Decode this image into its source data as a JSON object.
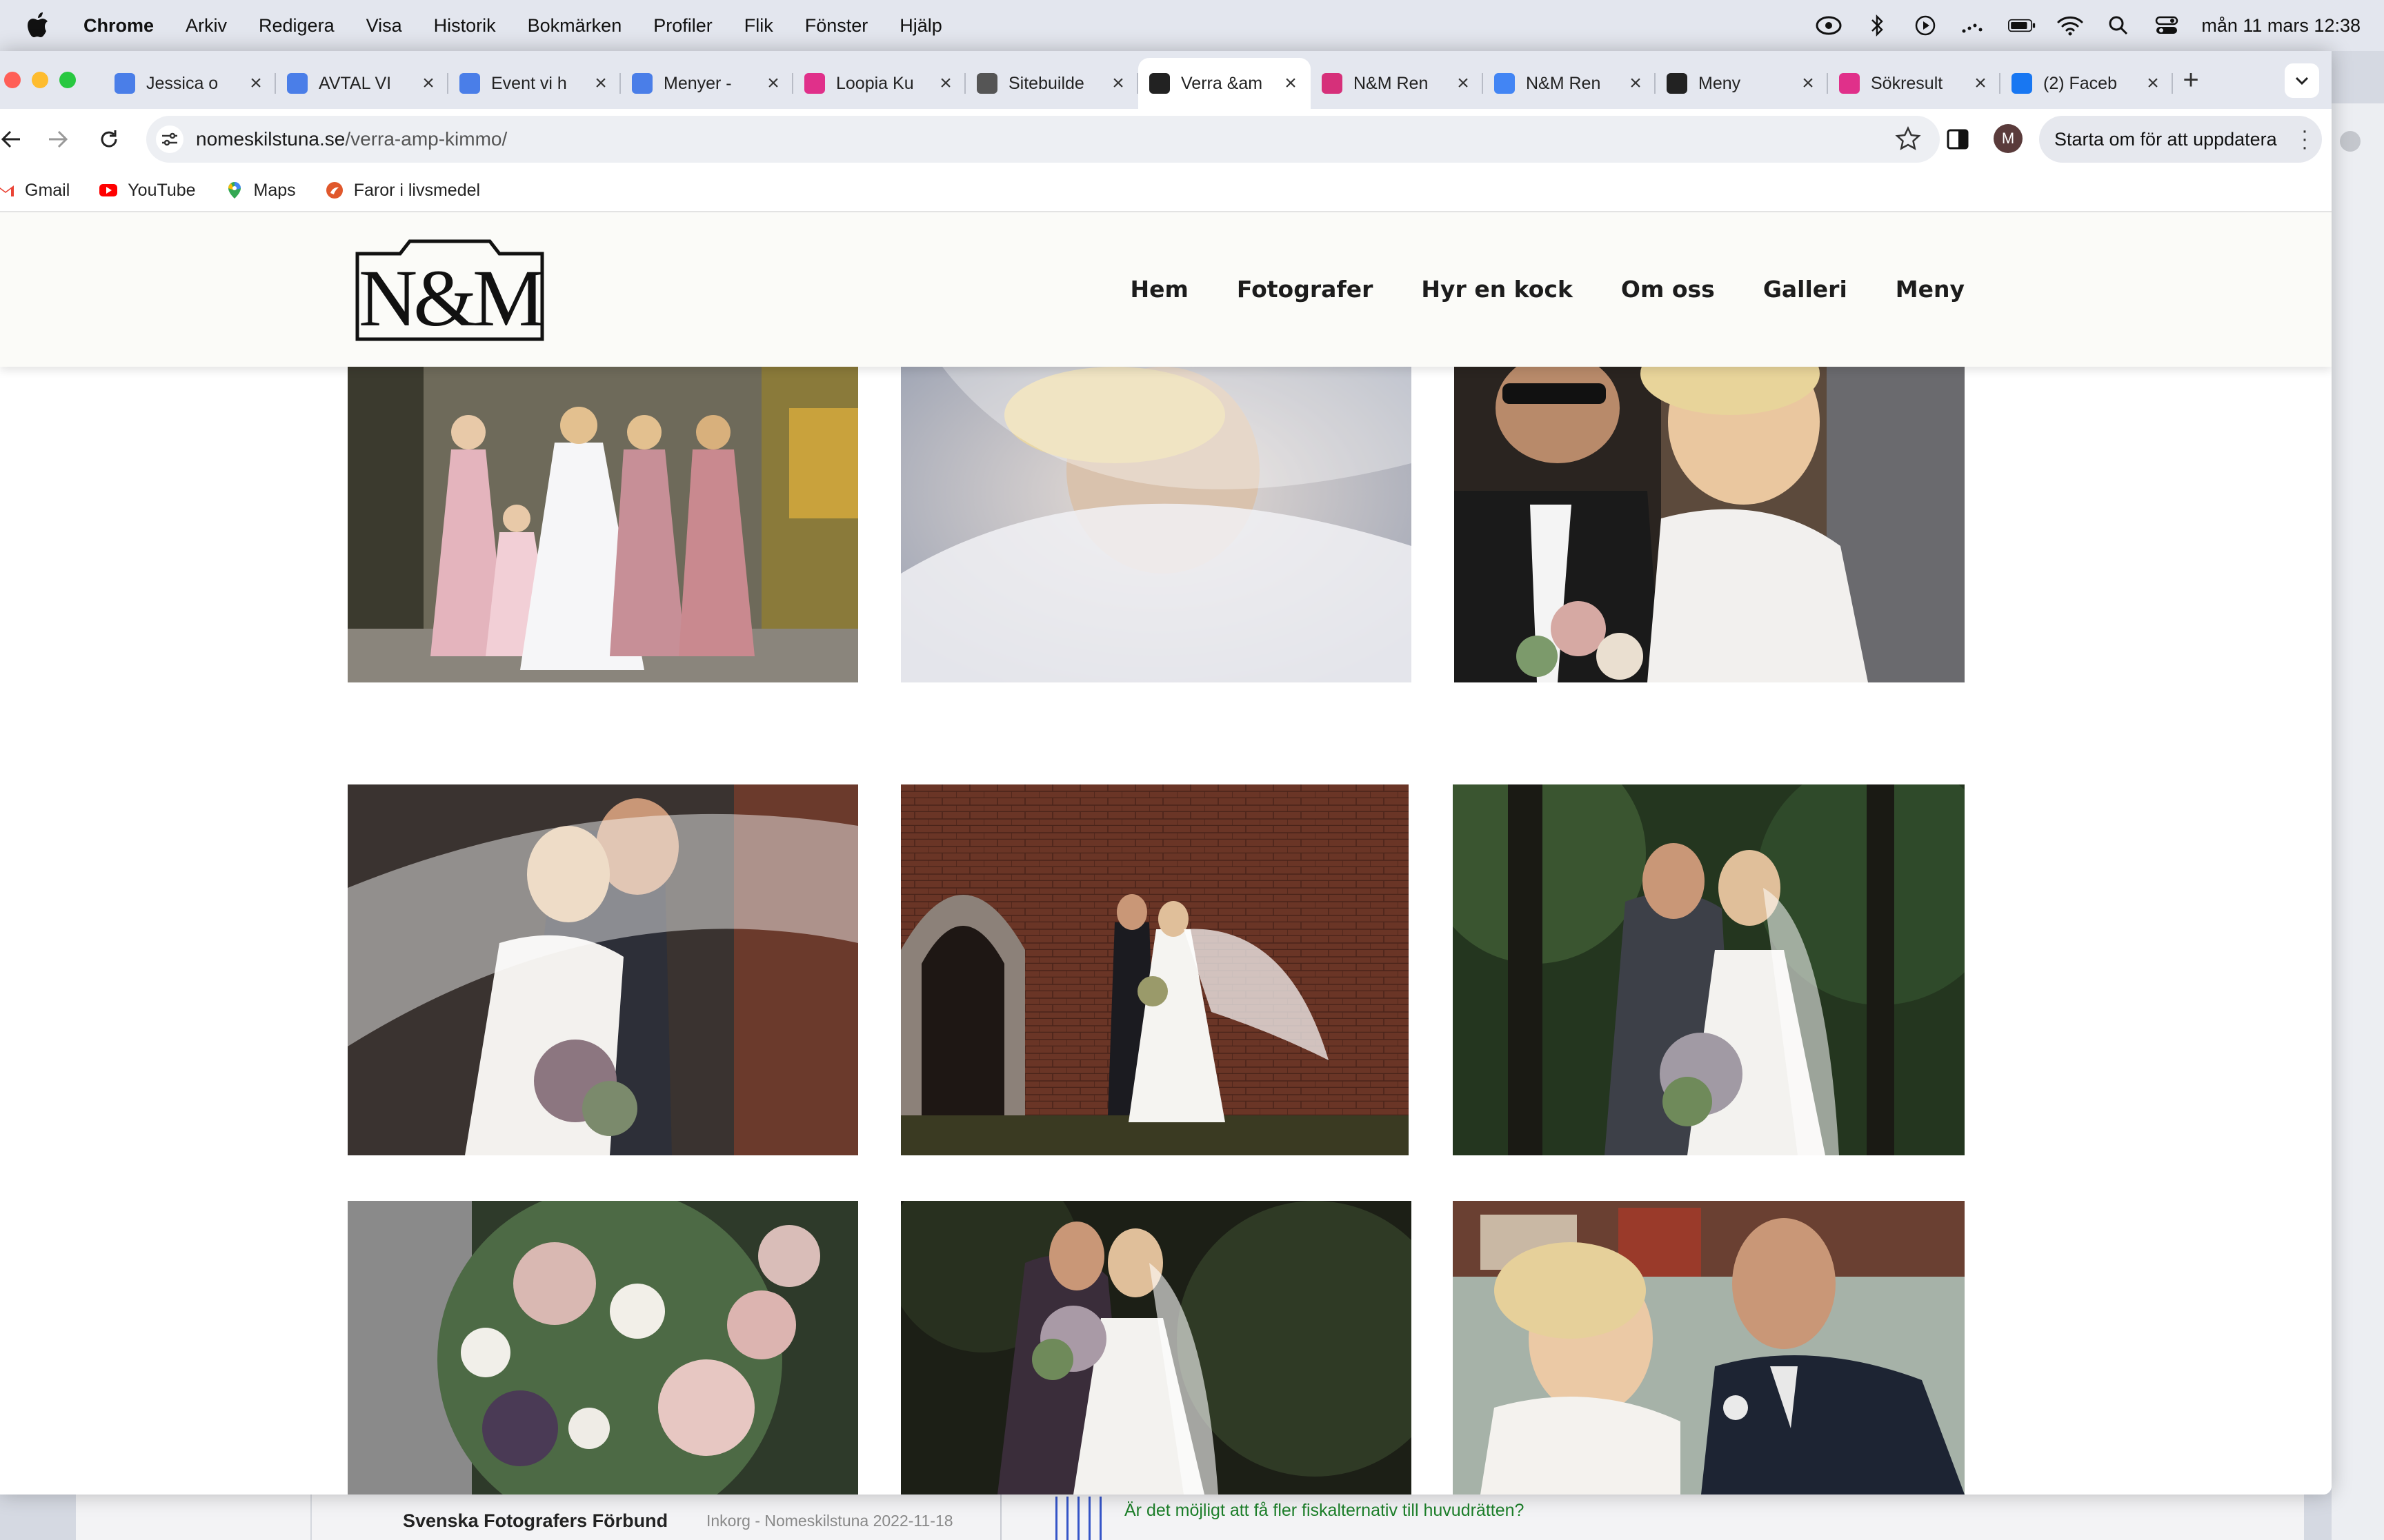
{
  "menubar": {
    "app": "Chrome",
    "items": [
      "Arkiv",
      "Redigera",
      "Visa",
      "Historik",
      "Bokmärken",
      "Profiler",
      "Flik",
      "Fönster",
      "Hjälp"
    ],
    "clock": "mån 11 mars 12:38"
  },
  "tabs": [
    {
      "title": "Jessica o",
      "icon": "docs-icon",
      "color": "#4a7ee8"
    },
    {
      "title": "AVTAL VI",
      "icon": "docs-icon",
      "color": "#4a7ee8"
    },
    {
      "title": "Event vi h",
      "icon": "docs-icon",
      "color": "#4a7ee8"
    },
    {
      "title": "Menyer -",
      "icon": "docs-icon",
      "color": "#4a7ee8"
    },
    {
      "title": "Loopia Ku",
      "icon": "loopia-icon",
      "color": "#e0308a"
    },
    {
      "title": "Sitebuilde",
      "icon": "globe-icon",
      "color": "#555555"
    },
    {
      "title": "Verra &am",
      "icon": "camera-icon",
      "color": "#222222",
      "active": true
    },
    {
      "title": "N&M Ren",
      "icon": "instagram-icon",
      "color": "#d6307a"
    },
    {
      "title": "N&M Ren",
      "icon": "google-icon",
      "color": "#4285f4"
    },
    {
      "title": "Meny",
      "icon": "camera-icon",
      "color": "#222222"
    },
    {
      "title": "Sökresult",
      "icon": "loopia-icon",
      "color": "#e0308a"
    },
    {
      "title": "(2) Faceb",
      "icon": "facebook-icon",
      "color": "#1877f2"
    }
  ],
  "address": {
    "domain": "nomeskilstuna.se",
    "path": "/verra-amp-kimmo/"
  },
  "profile_initial": "M",
  "update_label": "Starta om för att uppdatera",
  "bookmarks": [
    {
      "label": "Gmail",
      "icon": "gmail-icon"
    },
    {
      "label": "YouTube",
      "icon": "youtube-icon"
    },
    {
      "label": "Maps",
      "icon": "maps-icon"
    },
    {
      "label": "Faror i livsmedel",
      "icon": "faror-icon"
    }
  ],
  "site": {
    "logo_alt": "N&M",
    "nav": [
      "Hem",
      "Fotografer",
      "Hyr en kock",
      "Om oss",
      "Galleri",
      "Meny"
    ]
  },
  "gallery": [
    "bridesmaids-photo",
    "veil-closeup-photo",
    "couple-laughing-photo",
    "veil-kiss-photo",
    "church-wall-photo",
    "park-kiss-photo",
    "bouquet-photo",
    "forest-kiss-photo",
    "river-couple-photo"
  ],
  "background_mail": {
    "sender": "Svenska Fotografers Förbund",
    "meta": "Inkorg - Nomeskilstuna   2022-11-18",
    "snippet": "Är det möjligt att få fler fiskalternativ till huvudrätten?"
  }
}
